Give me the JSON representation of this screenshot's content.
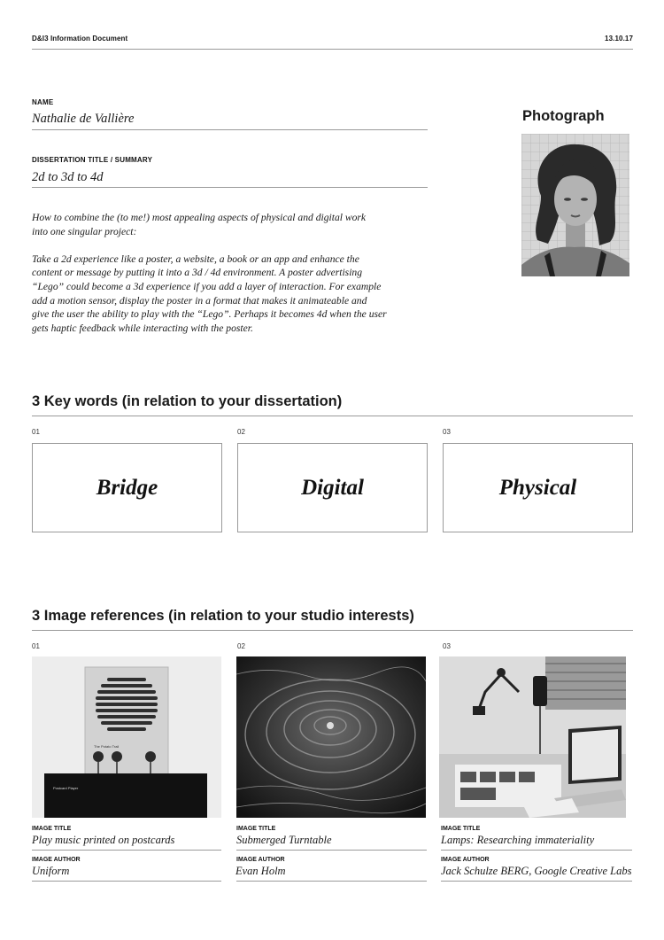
{
  "header": {
    "doc_title": "D&I3 Information Document",
    "date": "13.10.17"
  },
  "name": {
    "label": "NAME",
    "value": "Nathalie de Vallière"
  },
  "dissertation": {
    "label": "DISSERTATION TITLE / SUMMARY",
    "title": "2d to 3d to 4d",
    "summary_lines_p1": [
      "How to combine the (to me!) most appealing aspects of physical and digital work",
      "into one singular project:"
    ],
    "summary_lines_p2": [
      "Take a 2d experience like a poster, a website, a book or an app and enhance the",
      "content or message by putting it into a 3d / 4d environment. A poster advertising",
      "“Lego” could become a 3d experience if you add a layer of interaction. For example",
      "add a motion sensor, display the poster in a format that makes it animateable and",
      "give the user the ability to play with the “Lego”. Perhaps it becomes 4d when the user",
      "gets haptic feedback while interacting with the poster."
    ]
  },
  "photograph": {
    "heading": "Photograph"
  },
  "keywords": {
    "heading": "3 Key words (in relation to your dissertation)",
    "items": [
      {
        "num": "01",
        "word": "Bridge"
      },
      {
        "num": "02",
        "word": "Digital"
      },
      {
        "num": "03",
        "word": "Physical"
      }
    ]
  },
  "references": {
    "heading": "3 Image references (in relation to your studio interests)",
    "title_label": "IMAGE TITLE",
    "author_label": "IMAGE AUTHOR",
    "items": [
      {
        "num": "01",
        "title": "Play music printed on postcards",
        "author": "Uniform",
        "device_label": "The Potato Trail",
        "player_label": "Postcard Player"
      },
      {
        "num": "02",
        "title": "Submerged Turntable",
        "author": "Evan Holm"
      },
      {
        "num": "03",
        "title": "Lamps: Researching immateriality",
        "author": "Jack Schulze BERG, Google Creative Labs"
      }
    ]
  }
}
